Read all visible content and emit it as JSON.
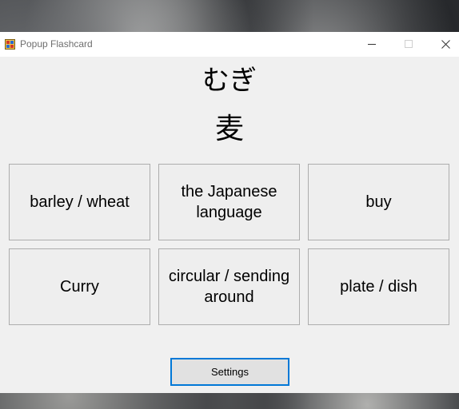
{
  "window": {
    "title": "Popup Flashcard",
    "icon": "flashcard-app-icon"
  },
  "card": {
    "reading": "むぎ",
    "kanji": "麦"
  },
  "answers": [
    {
      "label": "barley / wheat"
    },
    {
      "label": "the Japanese language"
    },
    {
      "label": "buy"
    },
    {
      "label": "Curry"
    },
    {
      "label": "circular / sending around"
    },
    {
      "label": "plate / dish"
    }
  ],
  "settings_label": "Settings",
  "colors": {
    "window_bg": "#f0f0f0",
    "focus_border": "#0078d7"
  }
}
